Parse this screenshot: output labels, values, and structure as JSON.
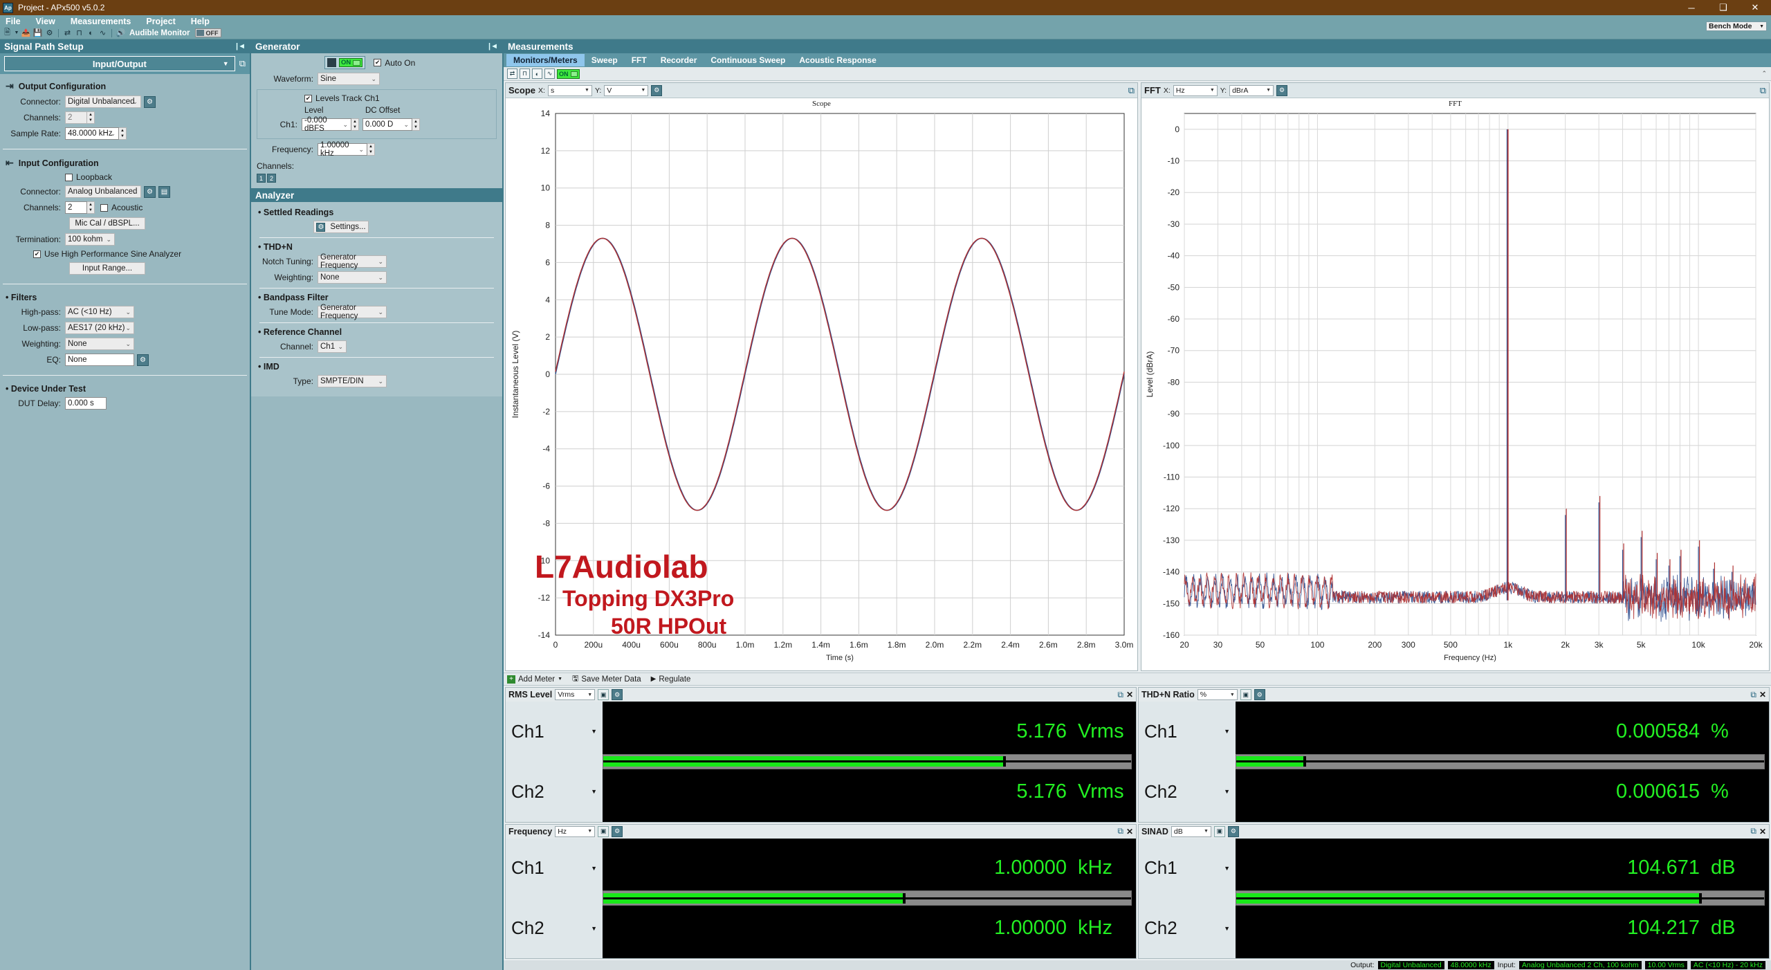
{
  "window": {
    "title": "Project - APx500 v5.0.2",
    "logo": "Ap",
    "minimize": "─",
    "maximize": "❑",
    "close": "✕"
  },
  "menubar": [
    "File",
    "View",
    "Measurements",
    "Project",
    "Help"
  ],
  "toolbar": {
    "icons": [
      "new-document-icon",
      "open-project-icon",
      "save-icon",
      "settings-icon",
      "signal-path-icon",
      "waveform-icon",
      "clock-icon",
      "trend-icon",
      "speaker-icon"
    ],
    "audible_monitor_label": "Audible Monitor",
    "audible_monitor_state": "OFF",
    "bench_mode": "Bench Mode"
  },
  "signal_path": {
    "title": "Signal Path Setup",
    "selector": "Input/Output",
    "output": {
      "heading": "Output Configuration",
      "connector_label": "Connector:",
      "connector_value": "Digital Unbalanced",
      "channels_label": "Channels:",
      "channels_value": "2",
      "sample_rate_label": "Sample Rate:",
      "sample_rate_value": "48.0000 kHz"
    },
    "input": {
      "heading": "Input Configuration",
      "loopback_label": "Loopback",
      "loopback_checked": false,
      "connector_label": "Connector:",
      "connector_value": "Analog Unbalanced",
      "channels_label": "Channels:",
      "channels_value": "2",
      "acoustic_label": "Acoustic",
      "mic_cal_label": "Mic Cal / dBSPL...",
      "termination_label": "Termination:",
      "termination_value": "100 kohm",
      "hpsa_label": "Use High Performance Sine Analyzer",
      "hpsa_checked": true,
      "input_range_label": "Input Range..."
    },
    "filters": {
      "heading": "Filters",
      "highpass_label": "High-pass:",
      "highpass_value": "AC (<10 Hz)",
      "lowpass_label": "Low-pass:",
      "lowpass_value": "AES17 (20 kHz)",
      "weighting_label": "Weighting:",
      "weighting_value": "None",
      "eq_label": "EQ:",
      "eq_value": "None"
    },
    "dut": {
      "heading": "Device Under Test",
      "delay_label": "DUT Delay:",
      "delay_value": "0.000 s"
    }
  },
  "generator": {
    "title": "Generator",
    "on_label": "ON",
    "auto_on_label": "Auto On",
    "auto_on_checked": true,
    "waveform_label": "Waveform:",
    "waveform_value": "Sine",
    "levels_track_label": "Levels Track Ch1",
    "levels_track_checked": true,
    "level_header": "Level",
    "dc_offset_header": "DC Offset",
    "ch1_label": "Ch1:",
    "level_value": "-0.000 dBFS",
    "dc_offset_value": "0.000 D",
    "frequency_label": "Frequency:",
    "frequency_value": "1.00000 kHz",
    "channels_label": "Channels:",
    "channel_buttons": [
      "1",
      "2"
    ]
  },
  "analyzer": {
    "title": "Analyzer",
    "settled_readings_heading": "Settled Readings",
    "settings_button": "Settings...",
    "thdn_heading": "THD+N",
    "notch_tuning_label": "Notch Tuning:",
    "notch_tuning_value": "Generator Frequency",
    "weighting_label": "Weighting:",
    "weighting_value": "None",
    "bandpass_heading": "Bandpass Filter",
    "tune_mode_label": "Tune Mode:",
    "tune_mode_value": "Generator Frequency",
    "reference_heading": "Reference Channel",
    "channel_label": "Channel:",
    "channel_value": "Ch1",
    "imd_heading": "IMD",
    "type_label": "Type:",
    "type_value": "SMPTE/DIN"
  },
  "measurements": {
    "title": "Measurements",
    "tabs": [
      "Monitors/Meters",
      "Sweep",
      "FFT",
      "Recorder",
      "Continuous Sweep",
      "Acoustic Response"
    ],
    "active_tab": "Monitors/Meters",
    "toolbar_state": "ON"
  },
  "scope": {
    "name": "Scope",
    "x_label": "X:",
    "x_value": "s",
    "y_label": "Y:",
    "y_value": "V",
    "chart_title": "Scope"
  },
  "fft": {
    "name": "FFT",
    "x_label": "X:",
    "x_value": "Hz",
    "y_label": "Y:",
    "y_value": "dBrA",
    "chart_title": "FFT"
  },
  "watermark": {
    "line1": "L7Audiolab",
    "line2": "Topping DX3Pro",
    "line3": "50R HPOut",
    "color": "#c1181e"
  },
  "meters_toolbar": {
    "add_meter": "Add Meter",
    "save_meter_data": "Save Meter Data",
    "regulate": "Regulate"
  },
  "meters": [
    {
      "name": "RMS Level",
      "unit_select": "Vrms",
      "rows": [
        {
          "channel": "Ch1",
          "value": "5.176",
          "unit": "Vrms",
          "bar_pct": 76
        },
        {
          "channel": "Ch2",
          "value": "5.176",
          "unit": "Vrms",
          "bar_pct": 76
        }
      ]
    },
    {
      "name": "THD+N Ratio",
      "unit_select": "%",
      "rows": [
        {
          "channel": "Ch1",
          "value": "0.000584",
          "unit": "%",
          "bar_pct": 13
        },
        {
          "channel": "Ch2",
          "value": "0.000615",
          "unit": "%",
          "bar_pct": 13
        }
      ]
    },
    {
      "name": "Frequency",
      "unit_select": "Hz",
      "rows": [
        {
          "channel": "Ch1",
          "value": "1.00000",
          "unit": "kHz",
          "bar_pct": 57
        },
        {
          "channel": "Ch2",
          "value": "1.00000",
          "unit": "kHz",
          "bar_pct": 57
        }
      ]
    },
    {
      "name": "SINAD",
      "unit_select": "dB",
      "rows": [
        {
          "channel": "Ch1",
          "value": "104.671",
          "unit": "dB",
          "bar_pct": 88
        },
        {
          "channel": "Ch2",
          "value": "104.217",
          "unit": "dB",
          "bar_pct": 88
        }
      ]
    }
  ],
  "statusbar": {
    "output_label": "Output:",
    "output_connector": "Digital Unbalanced",
    "output_rate": "48.0000 kHz",
    "input_label": "Input:",
    "input_connector": "Analog Unbalanced 2 Ch, 100 kohm",
    "input_range": "10.00 Vrms",
    "input_filter": "AC (<10 Hz) - 20 kHz"
  },
  "chart_data": [
    {
      "type": "line",
      "title": "Scope",
      "xlabel": "Time (s)",
      "ylabel": "Instantaneous Level (V)",
      "xlim": [
        0,
        0.003
      ],
      "ylim": [
        -14,
        14
      ],
      "xticks": [
        "0",
        "200u",
        "400u",
        "600u",
        "800u",
        "1.0m",
        "1.2m",
        "1.4m",
        "1.6m",
        "1.8m",
        "2.0m",
        "2.2m",
        "2.4m",
        "2.6m",
        "2.8m",
        "3.0m"
      ],
      "yticks": [
        "14",
        "12",
        "10",
        "8",
        "6",
        "4",
        "2",
        "0",
        "-2",
        "-4",
        "-6",
        "-8",
        "-10",
        "-12",
        "-14"
      ],
      "grid": true,
      "series": [
        {
          "name": "Ch1",
          "color": "#2f4f8f",
          "waveform": "sine",
          "amplitude": 7.3,
          "frequency_hz": 1000,
          "phase_deg": 0
        },
        {
          "name": "Ch2",
          "color": "#b03030",
          "waveform": "sine",
          "amplitude": 7.3,
          "frequency_hz": 1000,
          "phase_deg": 0
        }
      ]
    },
    {
      "type": "line",
      "title": "FFT",
      "xlabel": "Frequency (Hz)",
      "ylabel": "Level (dBrA)",
      "xlim": [
        20,
        20000
      ],
      "ylim": [
        -160,
        5
      ],
      "xscale": "log",
      "xticks": [
        "20",
        "30",
        "50",
        "100",
        "200",
        "300",
        "500",
        "1k",
        "2k",
        "3k",
        "5k",
        "10k",
        "20k"
      ],
      "yticks": [
        "0",
        "-10",
        "-20",
        "-30",
        "-40",
        "-50",
        "-60",
        "-70",
        "-80",
        "-90",
        "-100",
        "-110",
        "-120",
        "-130",
        "-140",
        "-150",
        "-160"
      ],
      "grid": true,
      "series": [
        {
          "name": "Ch1",
          "color": "#2f4f8f",
          "noise_floor_db": -148,
          "fundamental_hz": 1000,
          "fundamental_db": 0
        },
        {
          "name": "Ch2",
          "color": "#b03030",
          "noise_floor_db": -148,
          "fundamental_hz": 1000,
          "fundamental_db": 0
        }
      ],
      "harmonics": [
        {
          "hz": 2000,
          "db": -122
        },
        {
          "hz": 3000,
          "db": -118
        },
        {
          "hz": 4000,
          "db": -133
        },
        {
          "hz": 5000,
          "db": -129
        },
        {
          "hz": 6000,
          "db": -136
        },
        {
          "hz": 7000,
          "db": -138
        },
        {
          "hz": 8000,
          "db": -135
        },
        {
          "hz": 10000,
          "db": -132
        },
        {
          "hz": 12000,
          "db": -139
        },
        {
          "hz": 15000,
          "db": -140
        }
      ]
    }
  ]
}
